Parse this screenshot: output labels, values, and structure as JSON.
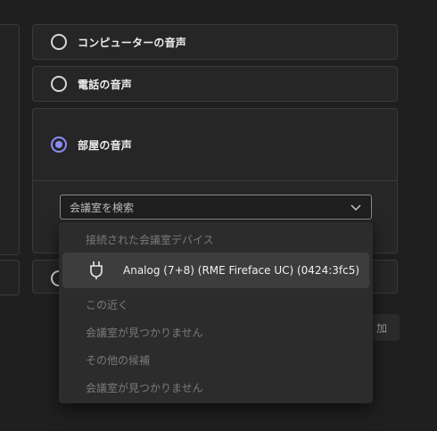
{
  "options": [
    {
      "label": "コンピューターの音声",
      "checked": false
    },
    {
      "label": "電話の音声",
      "checked": false
    },
    {
      "label": "部屋の音声",
      "checked": true
    },
    {
      "label": "",
      "checked": false
    }
  ],
  "room_search": {
    "placeholder": "会議室を検索",
    "icon": "chevron-down-icon"
  },
  "add_button": {
    "label": "加"
  },
  "popup": {
    "connected_header": "接続された会議室デバイス",
    "connected_device": {
      "label": "Analog (7+8) (RME Fireface UC) (0424:3fc5)",
      "icon": "plug-icon"
    },
    "nearby_header": "この近く",
    "nearby_empty": "会議室が見つかりません",
    "other_header": "その他の候補",
    "other_empty": "会議室が見つかりません"
  },
  "colors": {
    "accent": "#8b8cf5",
    "background": "#1f1f1f",
    "card": "#262626",
    "popup": "#2c2c2c",
    "highlight": "#3d3d3d"
  }
}
